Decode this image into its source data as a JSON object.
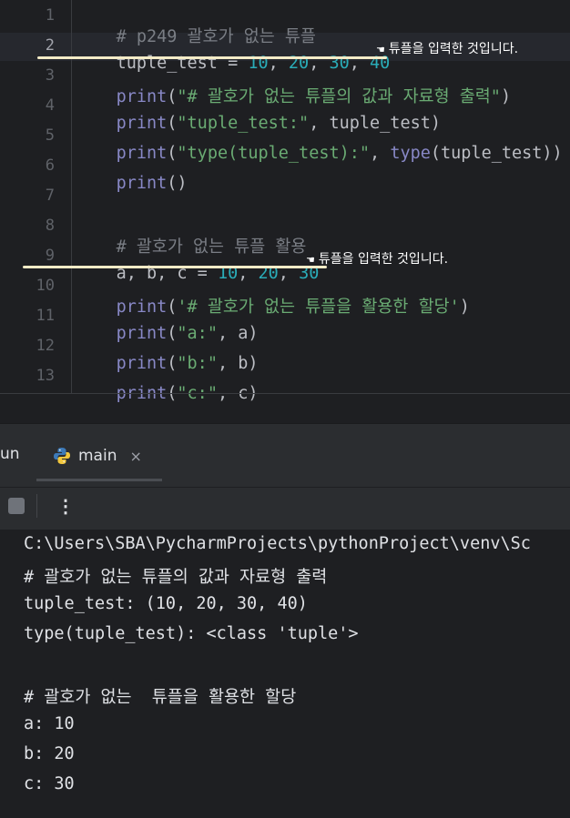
{
  "editor": {
    "line_numbers": [
      "1",
      "2",
      "3",
      "4",
      "5",
      "6",
      "7",
      "8",
      "9",
      "10",
      "11",
      "12",
      "13"
    ],
    "line1_comment": "# p249 괄호가 없는 튜플",
    "line2": {
      "var": "tuple_test = ",
      "n1": "10",
      "c1": ", ",
      "n2": "20",
      "c2": ", ",
      "n3": "30",
      "c3": ", ",
      "n4": "40"
    },
    "line3": {
      "fn": "print",
      "open": "(",
      "str": "\"# 괄호가 없는 튜플의 값과 자료형 출력\"",
      "close": ")"
    },
    "line4": {
      "fn": "print",
      "open": "(",
      "str": "\"tuple_test:\"",
      "rest": ", tuple_test)"
    },
    "line5": {
      "fn": "print",
      "open": "(",
      "str": "\"type(tuple_test):\"",
      "sep": ", ",
      "fn2": "type",
      "rest": "(tuple_test))"
    },
    "line6": {
      "fn": "print",
      "rest": "()"
    },
    "line8_comment": "# 괄호가 없는 튜플 활용",
    "line9": {
      "vars": "a, b, c = ",
      "n1": "10",
      "c1": ", ",
      "n2": "20",
      "c2": ", ",
      "n3": "30"
    },
    "line10": {
      "fn": "print",
      "open": "(",
      "str": "'# 괄호가 없는 튜플을 활용한 할당'",
      "close": ")"
    },
    "line11": {
      "fn": "print",
      "open": "(",
      "str": "\"a:\"",
      "rest": ", a)"
    },
    "line12": {
      "fn": "print",
      "open": "(",
      "str": "\"b:\"",
      "rest": ", b)"
    },
    "line13": {
      "fn": "print",
      "open": "(",
      "str": "\"c:\"",
      "rest": ", c)"
    }
  },
  "annotations": {
    "note1": "튜플을 입력한 것입니다.",
    "note2": "튜플을 입력한 것입니다.",
    "hand_icon": "pointing-hand-icon",
    "underline_color": "#f3ebc6"
  },
  "run_panel": {
    "tab_partial": "un",
    "tab_main": "main",
    "tab_close": "×",
    "more": "⋮"
  },
  "console": {
    "lines": [
      "C:\\Users\\SBA\\PycharmProjects\\pythonProject\\venv\\Sc",
      "# 괄호가 없는 튜플의 값과 자료형 출력",
      "tuple_test: (10, 20, 30, 40)",
      "type(tuple_test): <class 'tuple'>",
      "",
      "# 괄호가 없는  튜플을 활용한 할당",
      "a: 10",
      "b: 20",
      "c: 30"
    ]
  }
}
